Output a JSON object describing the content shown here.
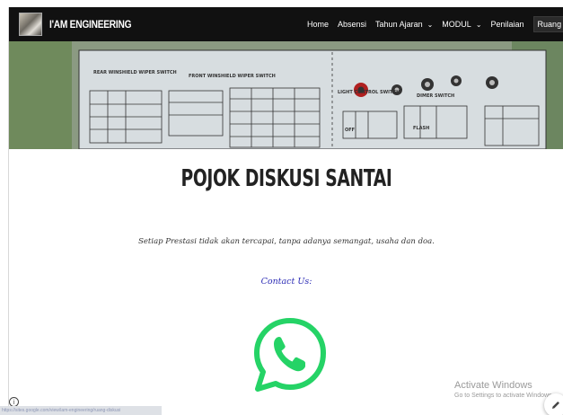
{
  "site": {
    "brand": "I'AM ENGINEERING",
    "logo_icon": "logo-image"
  },
  "nav": {
    "items": [
      {
        "label": "Home",
        "dropdown": false
      },
      {
        "label": "Absensi",
        "dropdown": false
      },
      {
        "label": "Tahun Ajaran",
        "dropdown": true
      },
      {
        "label": "MODUL",
        "dropdown": true
      },
      {
        "label": "Penilaian",
        "dropdown": false
      },
      {
        "label": "Ruang DISKUSI",
        "dropdown": false,
        "active": true
      }
    ],
    "search_icon": "search-icon"
  },
  "hero": {
    "labels": [
      "REAR WINSHIELD WIPER SWITCH",
      "FRONT WINSHIELD WIPER SWITCH",
      "LIGHT CONTROL SWITCH",
      "DIMER SWITCH",
      "FLASH",
      "OFF"
    ]
  },
  "main": {
    "title": "POJOK DISKUSI SANTAI",
    "tagline": "Setiap Prestasi tidak akan tercapai, tanpa adanya semangat, usaha dan doa.",
    "contact_label": "Contact Us:",
    "whatsapp_icon": "whatsapp-icon"
  },
  "watermark": {
    "title": "Activate Windows",
    "subtitle": "Go to Settings to activate Windows."
  },
  "status_bar": {
    "url": "https://sites.google.com/view/iam-engineering/ruang-diskusi"
  },
  "colors": {
    "navbar_bg": "#111111",
    "contact_text": "#2b2bb5",
    "whatsapp_green": "#25d366"
  }
}
